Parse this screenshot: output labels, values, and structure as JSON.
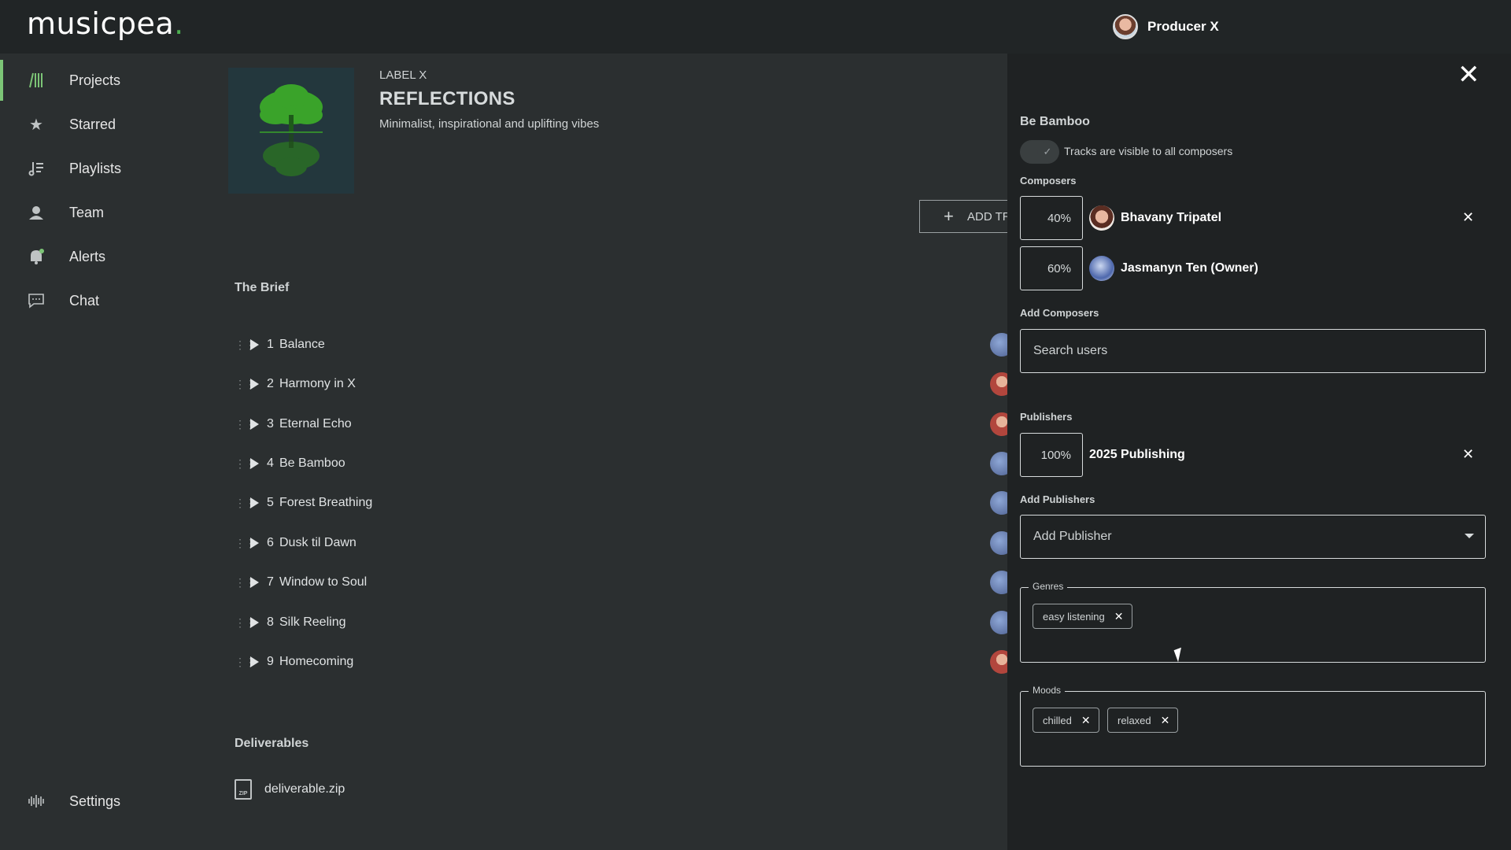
{
  "app": {
    "logo_text": "musicpea",
    "logo_dot": "."
  },
  "user": {
    "name": "Producer X"
  },
  "sidebar": {
    "items": [
      {
        "label": "Projects",
        "icon": "projects-icon"
      },
      {
        "label": "Starred",
        "icon": "star-icon"
      },
      {
        "label": "Playlists",
        "icon": "playlist-icon"
      },
      {
        "label": "Team",
        "icon": "team-icon"
      },
      {
        "label": "Alerts",
        "icon": "bell-icon"
      },
      {
        "label": "Chat",
        "icon": "chat-icon"
      }
    ],
    "settings": {
      "label": "Settings",
      "icon": "settings-icon"
    }
  },
  "project": {
    "label": "LABEL X",
    "title": "REFLECTIONS",
    "description": "Minimalist, inspirational and uplifting vibes",
    "add_tracks_label": "ADD TRA"
  },
  "brief": {
    "title": "The Brief",
    "tracks": [
      {
        "num": "1",
        "name": "Balance"
      },
      {
        "num": "2",
        "name": "Harmony in X"
      },
      {
        "num": "3",
        "name": "Eternal Echo"
      },
      {
        "num": "4",
        "name": "Be Bamboo"
      },
      {
        "num": "5",
        "name": "Forest Breathing"
      },
      {
        "num": "6",
        "name": "Dusk til Dawn"
      },
      {
        "num": "7",
        "name": "Window to Soul"
      },
      {
        "num": "8",
        "name": "Silk Reeling"
      },
      {
        "num": "9",
        "name": "Homecoming"
      }
    ]
  },
  "deliverables": {
    "title": "Deliverables",
    "file": "deliverable.zip",
    "file_icon_text": "ZIP"
  },
  "panel": {
    "track_title": "Be Bamboo",
    "visibility_label": "Tracks are visible to all composers",
    "composers_label": "Composers",
    "composers": [
      {
        "percent": "40%",
        "name": "Bhavany Tripatel"
      },
      {
        "percent": "60%",
        "name": "Jasmanyn Ten (Owner)"
      }
    ],
    "add_composers_label": "Add Composers",
    "search_placeholder": "Search users",
    "publishers_label": "Publishers",
    "publishers": [
      {
        "percent": "100%",
        "name": "2025 Publishing"
      }
    ],
    "add_publishers_label": "Add Publishers",
    "add_publisher_placeholder": "Add Publisher",
    "genres_label": "Genres",
    "genres": [
      "easy listening"
    ],
    "moods_label": "Moods",
    "moods": [
      "chilled",
      "relaxed"
    ]
  }
}
